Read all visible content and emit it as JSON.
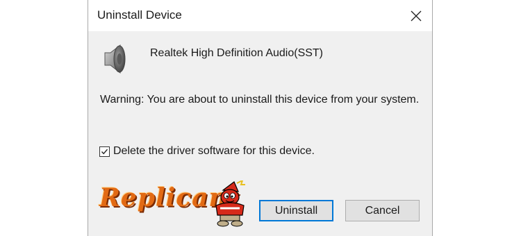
{
  "dialog": {
    "title": "Uninstall Device",
    "device_name": "Realtek High Definition Audio(SST)",
    "warning": "Warning: You are about to uninstall this device from your system.",
    "checkbox": {
      "label": "Delete the driver software for this device.",
      "checked": true
    },
    "buttons": {
      "uninstall_label": "Uninstall",
      "cancel_label": "Cancel"
    },
    "watermark": "Replicant"
  },
  "icons": {
    "close": "close-icon",
    "device": "speaker-icon",
    "checkmark": "checkmark-icon",
    "mascot": "mascot-logo"
  },
  "colors": {
    "dialog_bg": "#f0f0f0",
    "titlebar_bg": "#ffffff",
    "primary_border": "#0078d7",
    "watermark": "#e26a14"
  }
}
